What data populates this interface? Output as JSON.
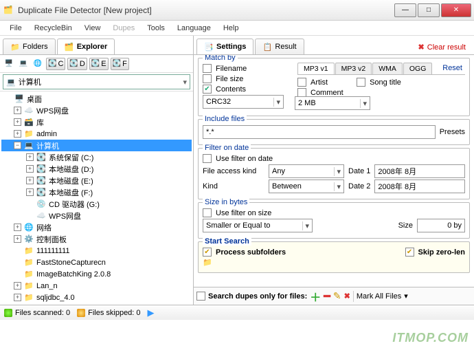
{
  "window": {
    "title": "Duplicate File Detector [New project]"
  },
  "menu": {
    "file": "File",
    "recycle": "RecycleBin",
    "view": "View",
    "dupes": "Dupes",
    "tools": "Tools",
    "language": "Language",
    "help": "Help"
  },
  "left_tabs": {
    "folders": "Folders",
    "explorer": "Explorer"
  },
  "right_tabs": {
    "settings": "Settings",
    "result": "Result",
    "clear": "Clear result"
  },
  "drives_row": {
    "c": "C",
    "d": "D",
    "e": "E",
    "f": "F"
  },
  "location_combo": "计算机",
  "tree": {
    "desktop": "桌面",
    "wps": "WPS网盘",
    "libraries": "库",
    "admin": "admin",
    "computer": "计算机",
    "sysres": "系统保留 (C:)",
    "diskd": "本地磁盘 (D:)",
    "diske": "本地磁盘 (E:)",
    "diskf": "本地磁盘 (F:)",
    "cd": "CD 驱动器 (G:)",
    "wps2": "WPS网盘",
    "network": "网络",
    "ctrl": "控制面板",
    "f1": "111111111",
    "f2": "FastStoneCapturecn",
    "f3": "ImageBatchKing 2.0.8",
    "f4": "Lan_n",
    "f5": "sqljdbc_4.0"
  },
  "match": {
    "legend": "Match by",
    "filename": "Filename",
    "filesize": "File size",
    "contents": "Contents",
    "hash_sel": "CRC32",
    "size_sel": "2 MB",
    "sub_tabs": {
      "mp3v1": "MP3 v1",
      "mp3v2": "MP3 v2",
      "wma": "WMA",
      "ogg": "OGG",
      "reset": "Reset"
    },
    "artist": "Artist",
    "songtitle": "Song title",
    "comment": "Comment"
  },
  "include": {
    "legend": "Include files",
    "mask": "*.*",
    "presets": "Presets"
  },
  "filter_date": {
    "legend": "Filter on date",
    "use": "Use filter on date",
    "fak": "File access kind",
    "any": "Any",
    "kind": "Kind",
    "between": "Between",
    "date1": "Date 1",
    "date2": "Date 2",
    "d1v": "2008年  8月",
    "d2v": "2008年  8月"
  },
  "filter_size": {
    "legend": "Size in bytes",
    "use": "Use filter on size",
    "cmp": "Smaller or Equal to",
    "size": "Size",
    "val": "0 by"
  },
  "start": {
    "legend": "Start Search",
    "process": "Process subfolders",
    "skip": "Skip zero-len"
  },
  "bottom": {
    "search_dupes": "Search dupes only for files:",
    "mark": "Mark All Files"
  },
  "status": {
    "scanned": "Files scanned: 0",
    "skipped": "Files skipped: 0"
  },
  "watermark": "ITMOP.COM"
}
